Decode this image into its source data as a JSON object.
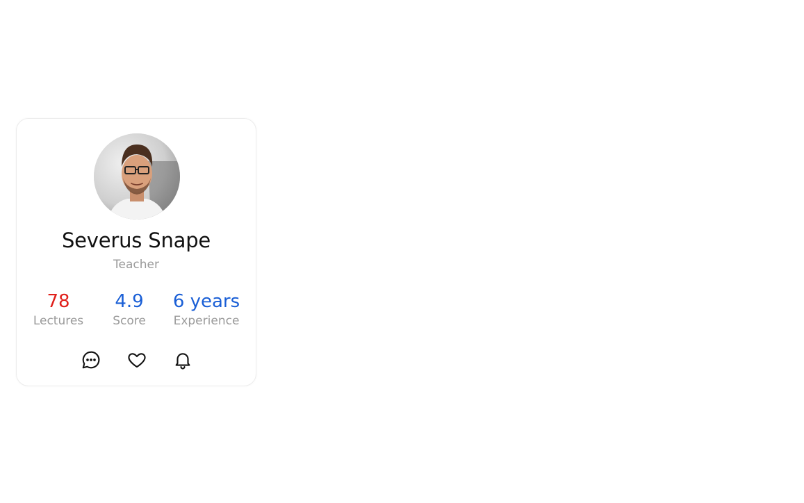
{
  "profile": {
    "name": "Severus Snape",
    "role": "Teacher"
  },
  "stats": [
    {
      "value": "78",
      "label": "Lectures",
      "color": "#e0201b"
    },
    {
      "value": "4.9",
      "label": "Score",
      "color": "#1a5fd6"
    },
    {
      "value": "6 years",
      "label": "Experience",
      "color": "#1a5fd6"
    }
  ],
  "actions": [
    {
      "icon": "message-icon"
    },
    {
      "icon": "heart-icon"
    },
    {
      "icon": "bell-icon"
    }
  ]
}
